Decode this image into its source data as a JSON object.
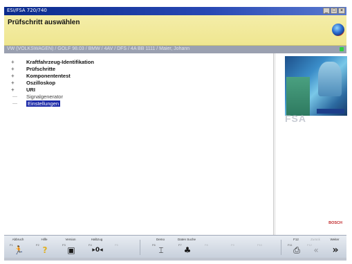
{
  "window": {
    "title": "ESI/FSA 720/740",
    "controls": [
      "_",
      "□",
      "×"
    ]
  },
  "header": {
    "title": "Prüfschritt auswählen",
    "icon": "globe-icon"
  },
  "vehicle_info": "VW (VOLKSWAGEN) / GOLF 98.03 / BMW / 4AV / DFS / 4A BB 1111 / Maier, Johann",
  "tree": [
    {
      "label": "Kraftfahrzeug-Identifikation",
      "expander": "+",
      "style": "bold"
    },
    {
      "label": "Prüfschritte",
      "expander": "+",
      "style": "bold"
    },
    {
      "label": "Komponententest",
      "expander": "+",
      "style": "bold"
    },
    {
      "label": "Oszilloskop",
      "expander": "+",
      "style": "bold"
    },
    {
      "label": "URI",
      "expander": "+",
      "style": "bold"
    },
    {
      "label": "Signalgenerator",
      "expander": "—",
      "style": "plain"
    },
    {
      "label": "Einstellungen",
      "expander": "—",
      "style": "selected"
    }
  ],
  "right_panel": {
    "product": "FSA",
    "brand": "BOSCH"
  },
  "toolbar": [
    {
      "label": "Abbruch",
      "fkey": "F1",
      "icon": "abort-icon",
      "glyph": "🏃",
      "enabled": true
    },
    {
      "label": "Hilfe",
      "fkey": "F2",
      "icon": "help-icon",
      "glyph": "?",
      "enabled": true
    },
    {
      "label": "Version",
      "fkey": "F3",
      "icon": "version-icon",
      "glyph": "▣",
      "enabled": true
    },
    {
      "label": "Halbzug",
      "fkey": "F4",
      "icon": "signal-icon",
      "glyph": "▸0◂",
      "enabled": true
    },
    {
      "label": "",
      "fkey": "F5",
      "icon": "blank-icon",
      "glyph": "",
      "enabled": false
    },
    {
      "label": "Demo",
      "fkey": "F6",
      "icon": "demo-icon",
      "glyph": "⌶",
      "enabled": true
    },
    {
      "label": "Daten Suche",
      "fkey": "F7",
      "icon": "data-search-icon",
      "glyph": "♣",
      "enabled": true
    },
    {
      "label": "",
      "fkey": "F8",
      "icon": "blank-icon",
      "glyph": "",
      "enabled": false
    },
    {
      "label": "",
      "fkey": "F9",
      "icon": "blank-icon",
      "glyph": "",
      "enabled": false
    },
    {
      "label": "",
      "fkey": "F10",
      "icon": "blank-icon",
      "glyph": "",
      "enabled": false
    },
    {
      "label": "F12",
      "fkey": "F11",
      "icon": "print-icon",
      "glyph": "⎙",
      "enabled": true
    },
    {
      "label": "Zurück",
      "fkey": "F12",
      "icon": "back-icon",
      "glyph": "«",
      "enabled": false
    },
    {
      "label": "Weiter",
      "fkey": "",
      "icon": "forward-icon",
      "glyph": "»",
      "enabled": true
    }
  ]
}
